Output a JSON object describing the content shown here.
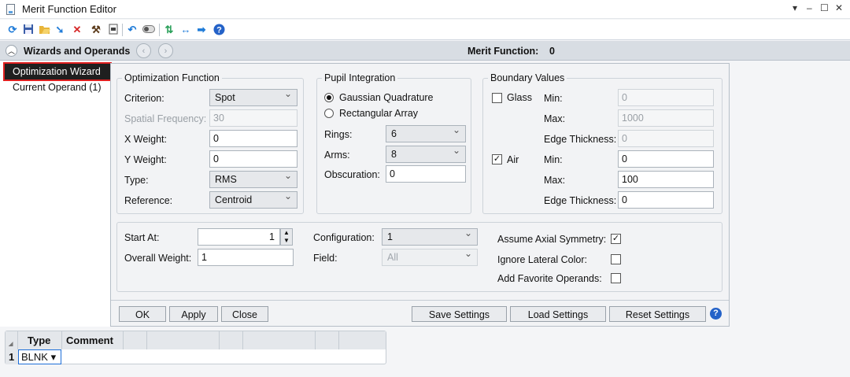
{
  "window": {
    "title": "Merit Function Editor",
    "controls": [
      "▾",
      "–",
      "☐",
      "✕"
    ]
  },
  "toolbar": {
    "icons": [
      "refresh-icon",
      "save-icon",
      "open-folder-icon",
      "insert-arrow-icon",
      "delete-icon",
      "wand-icon",
      "page-icon",
      "undo-icon",
      "toggle-icon",
      "swap-icon",
      "merge-icon",
      "forward-arrow-icon",
      "help-icon"
    ]
  },
  "section": {
    "title": "Wizards and Operands",
    "merit_label": "Merit Function:",
    "merit_value": "0"
  },
  "nav": {
    "items": [
      {
        "label": "Optimization Wizard",
        "selected": true
      },
      {
        "label": "Current Operand (1)",
        "selected": false
      }
    ]
  },
  "optimization_function": {
    "title": "Optimization Function",
    "criterion_label": "Criterion:",
    "criterion_value": "Spot",
    "spatial_frequency_label": "Spatial Frequency:",
    "spatial_frequency_value": "30",
    "x_weight_label": "X Weight:",
    "x_weight_value": "0",
    "y_weight_label": "Y Weight:",
    "y_weight_value": "0",
    "type_label": "Type:",
    "type_value": "RMS",
    "reference_label": "Reference:",
    "reference_value": "Centroid"
  },
  "pupil_integration": {
    "title": "Pupil Integration",
    "gaussian_label": "Gaussian Quadrature",
    "rectangular_label": "Rectangular Array",
    "rings_label": "Rings:",
    "rings_value": "6",
    "arms_label": "Arms:",
    "arms_value": "8",
    "obscuration_label": "Obscuration:",
    "obscuration_value": "0"
  },
  "boundary_values": {
    "title": "Boundary Values",
    "glass_label": "Glass",
    "glass_checked": false,
    "glass_min_label": "Min:",
    "glass_min_value": "0",
    "glass_max_label": "Max:",
    "glass_max_value": "1000",
    "glass_edge_label": "Edge Thickness:",
    "glass_edge_value": "0",
    "air_label": "Air",
    "air_checked": true,
    "air_min_label": "Min:",
    "air_min_value": "0",
    "air_max_label": "Max:",
    "air_max_value": "100",
    "air_edge_label": "Edge Thickness:",
    "air_edge_value": "0"
  },
  "general": {
    "start_at_label": "Start At:",
    "start_at_value": "1",
    "overall_weight_label": "Overall Weight:",
    "overall_weight_value": "1",
    "configuration_label": "Configuration:",
    "configuration_value": "1",
    "field_label": "Field:",
    "field_value": "All",
    "axial_symmetry_label": "Assume Axial Symmetry:",
    "axial_symmetry_checked": true,
    "ignore_lateral_label": "Ignore Lateral Color:",
    "ignore_lateral_checked": false,
    "favorite_label": "Add Favorite Operands:",
    "favorite_checked": false
  },
  "buttons": {
    "ok": "OK",
    "apply": "Apply",
    "close": "Close",
    "save_settings": "Save Settings",
    "load_settings": "Load Settings",
    "reset_settings": "Reset Settings",
    "help": "?"
  },
  "grid": {
    "headers": [
      "Type",
      "Comment"
    ],
    "rows": [
      {
        "num": "1",
        "type": "BLNK ▾"
      }
    ]
  },
  "colors": {
    "accent": "#1e6fd9",
    "selection_outline": "#e02020"
  }
}
